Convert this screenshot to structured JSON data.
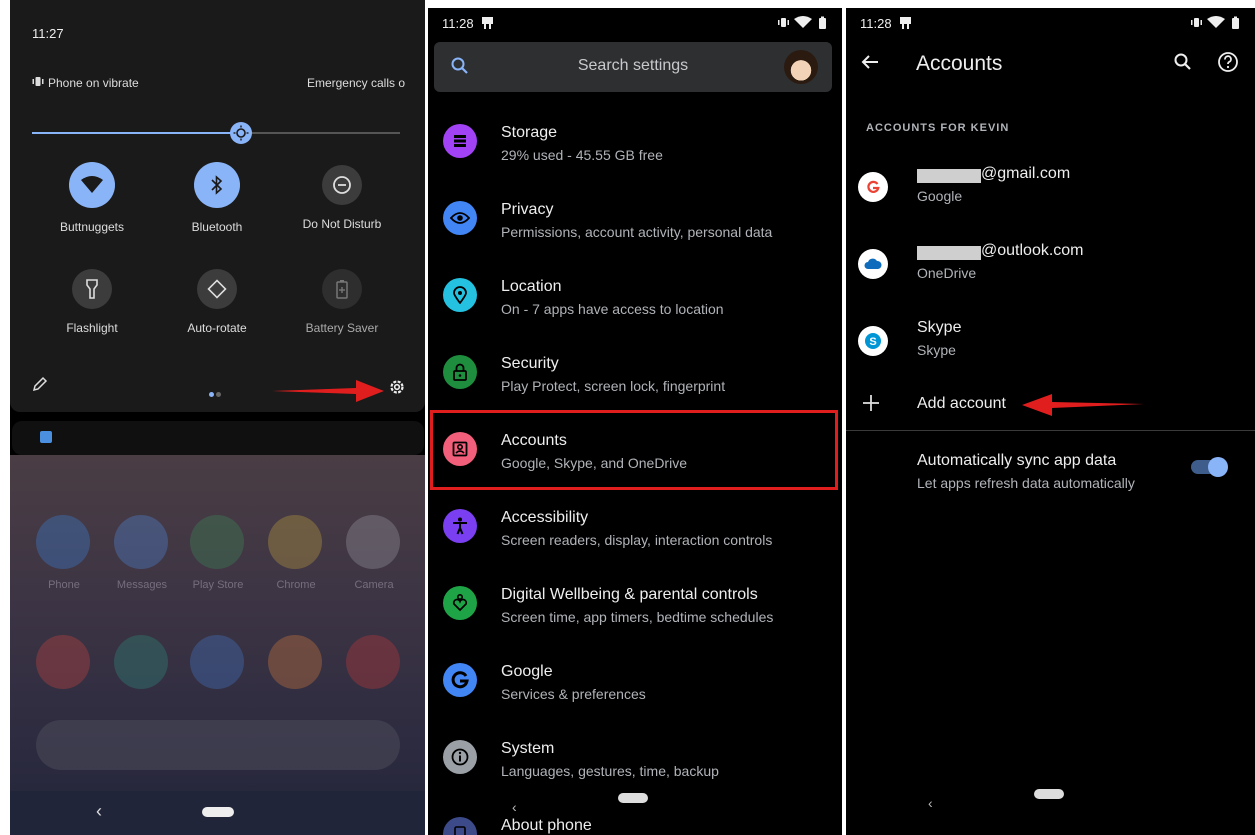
{
  "panel1": {
    "time": "11:27",
    "vibrate_label": "Phone on vibrate",
    "emergency_label": "Emergency calls o",
    "tiles": [
      {
        "label": "Buttnuggets",
        "icon": "wifi-icon",
        "state": "on"
      },
      {
        "label": "Bluetooth",
        "icon": "bluetooth-icon",
        "state": "on"
      },
      {
        "label": "Do Not Disturb",
        "icon": "do-not-disturb-icon",
        "state": "off"
      },
      {
        "label": "Flashlight",
        "icon": "flashlight-icon",
        "state": "off"
      },
      {
        "label": "Auto-rotate",
        "icon": "auto-rotate-icon",
        "state": "off"
      },
      {
        "label": "Battery Saver",
        "icon": "battery-saver-icon",
        "state": "disabled"
      }
    ],
    "brightness_level": 0.57,
    "apps": [
      "Phone",
      "Messages",
      "Play Store",
      "Chrome",
      "Camera"
    ]
  },
  "panel2": {
    "time": "11:28",
    "search_placeholder": "Search settings",
    "items": [
      {
        "title": "Storage",
        "subtitle": "29% used - 45.55 GB free",
        "icon": "storage-icon",
        "color": "#a142f4"
      },
      {
        "title": "Privacy",
        "subtitle": "Permissions, account activity, personal data",
        "icon": "privacy-eye-icon",
        "color": "#4285f4"
      },
      {
        "title": "Location",
        "subtitle": "On - 7 apps have access to location",
        "icon": "location-pin-icon",
        "color": "#24c1e0"
      },
      {
        "title": "Security",
        "subtitle": "Play Protect, screen lock, fingerprint",
        "icon": "lock-icon",
        "color": "#1e8e3e"
      },
      {
        "title": "Accounts",
        "subtitle": "Google, Skype, and OneDrive",
        "icon": "account-box-icon",
        "color": "#f25f7a"
      },
      {
        "title": "Accessibility",
        "subtitle": "Screen readers, display, interaction controls",
        "icon": "accessibility-icon",
        "color": "#7a3ff0"
      },
      {
        "title": "Digital Wellbeing & parental controls",
        "subtitle": "Screen time, app timers, bedtime schedules",
        "icon": "wellbeing-heart-icon",
        "color": "#1ea446"
      },
      {
        "title": "Google",
        "subtitle": "Services & preferences",
        "icon": "google-g-icon",
        "color": "#4285f4"
      },
      {
        "title": "System",
        "subtitle": "Languages, gestures, time, backup",
        "icon": "info-icon",
        "color": "#9aa0a6"
      },
      {
        "title": "About phone",
        "subtitle": "",
        "icon": "phone-icon",
        "color": "#3c4a8a"
      }
    ]
  },
  "panel3": {
    "time": "11:28",
    "title": "Accounts",
    "section_header": "ACCOUNTS FOR KEVIN",
    "accounts": [
      {
        "email_suffix": "@gmail.com",
        "provider": "Google",
        "icon": "google-logo-icon"
      },
      {
        "email_suffix": "@outlook.com",
        "provider": "OneDrive",
        "icon": "onedrive-cloud-icon"
      },
      {
        "name": "Skype",
        "provider": "Skype",
        "icon": "skype-logo-icon"
      }
    ],
    "add_account_label": "Add account",
    "sync_title": "Automatically sync app data",
    "sync_subtitle": "Let apps refresh data automatically",
    "sync_enabled": true
  },
  "colors": {
    "accent": "#8ab4f8",
    "highlight_red": "#e01e1e"
  }
}
